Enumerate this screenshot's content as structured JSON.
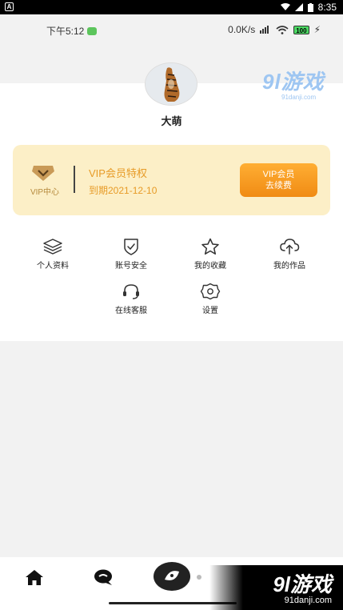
{
  "system_bar": {
    "app_icon": "A",
    "time": "8:35",
    "icons": [
      "wifi-icon",
      "signal-icon",
      "battery-icon"
    ]
  },
  "status_bar": {
    "time": "下午5:12",
    "speed": "0.0K/s",
    "battery": "100"
  },
  "watermark": {
    "brand": "9l游戏",
    "url": "91danji.com"
  },
  "profile": {
    "username": "大萌"
  },
  "vip": {
    "center_label": "VIP中心",
    "title": "VIP会员特权",
    "expire": "到期2021-12-10",
    "button_line1": "VIP会员",
    "button_line2": "去续费",
    "accent_color": "#e79b27",
    "card_color": "#fcefc7"
  },
  "menu": [
    {
      "label": "个人资料",
      "icon": "layers-icon"
    },
    {
      "label": "账号安全",
      "icon": "shield-check-icon"
    },
    {
      "label": "我的收藏",
      "icon": "star-icon"
    },
    {
      "label": "我的作品",
      "icon": "cloud-upload-icon"
    },
    {
      "label": "在线客服",
      "icon": "headset-icon"
    },
    {
      "label": "设置",
      "icon": "settings-icon"
    }
  ],
  "bottom_nav": {
    "items": [
      "home-icon",
      "chat-icon",
      "discover-icon"
    ]
  }
}
